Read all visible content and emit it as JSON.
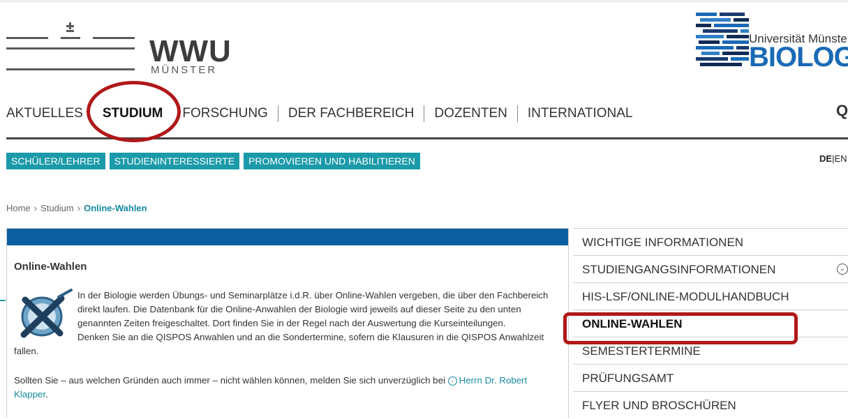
{
  "header": {
    "wwu_word": "WWU",
    "wwu_city": "MÜNSTER",
    "bio_university": "Universität Münster",
    "bio_word": "BIOLOGIE",
    "search_glyph": "Q"
  },
  "main_nav": {
    "items": [
      "AKTUELLES",
      "STUDIUM",
      "FORSCHUNG",
      "DER FACHBEREICH",
      "DOZENTEN",
      "INTERNATIONAL"
    ],
    "active": "STUDIUM"
  },
  "audience_nav": {
    "items": [
      "SCHÜLER/LEHRER",
      "STUDIENINTERESSIERTE",
      "PROMOVIEREN UND HABILITIEREN"
    ]
  },
  "language": {
    "current": "DE",
    "separator": "|",
    "other": "EN"
  },
  "breadcrumb": [
    "Home",
    "Studium",
    "Online-Wahlen"
  ],
  "content": {
    "title": "Online-Wahlen",
    "paragraph1": "In der Biologie werden Übungs- und Seminarplätze i.d.R. über Online-Wahlen vergeben, die über den Fachbereich direkt laufen. Die Datenbank für die Online-Anwahlen der Biologie wird jeweils auf dieser Seite zu den unten genannten Zeiten freigeschaltet. Dort finden Sie in der Regel nach der Auswertung die Kurseinteilungen.",
    "paragraph1b": "Denken Sie an die QISPOS Anwahlen und an die Sondertermine, sofern die Klausuren in die QISPOS Anwahlzeit fallen.",
    "paragraph2_prefix": "Sollten Sie – aus welchen Gründen auch immer – nicht wählen können, melden Sie sich unverzüglich bei",
    "paragraph2_link": "Herrn Dr. Robert Klapper",
    "paragraph2_suffix": "."
  },
  "side_nav": {
    "items": [
      {
        "label": "WICHTIGE INFORMATIONEN"
      },
      {
        "label": "STUDIENGANGSINFORMATIONEN"
      },
      {
        "label": "HIS-LSF/ONLINE-MODULHANDBUCH"
      },
      {
        "label": "ONLINE-WAHLEN"
      },
      {
        "label": "SEMESTERTERMINE"
      },
      {
        "label": "PRÜFUNGSAMT"
      },
      {
        "label": "FLYER UND BROSCHÜREN"
      }
    ],
    "active": "ONLINE-WAHLEN"
  },
  "colors": {
    "accent_teal": "#1b9aa9",
    "header_blue": "#0d5fa0",
    "annotation_red": "#b01818"
  }
}
